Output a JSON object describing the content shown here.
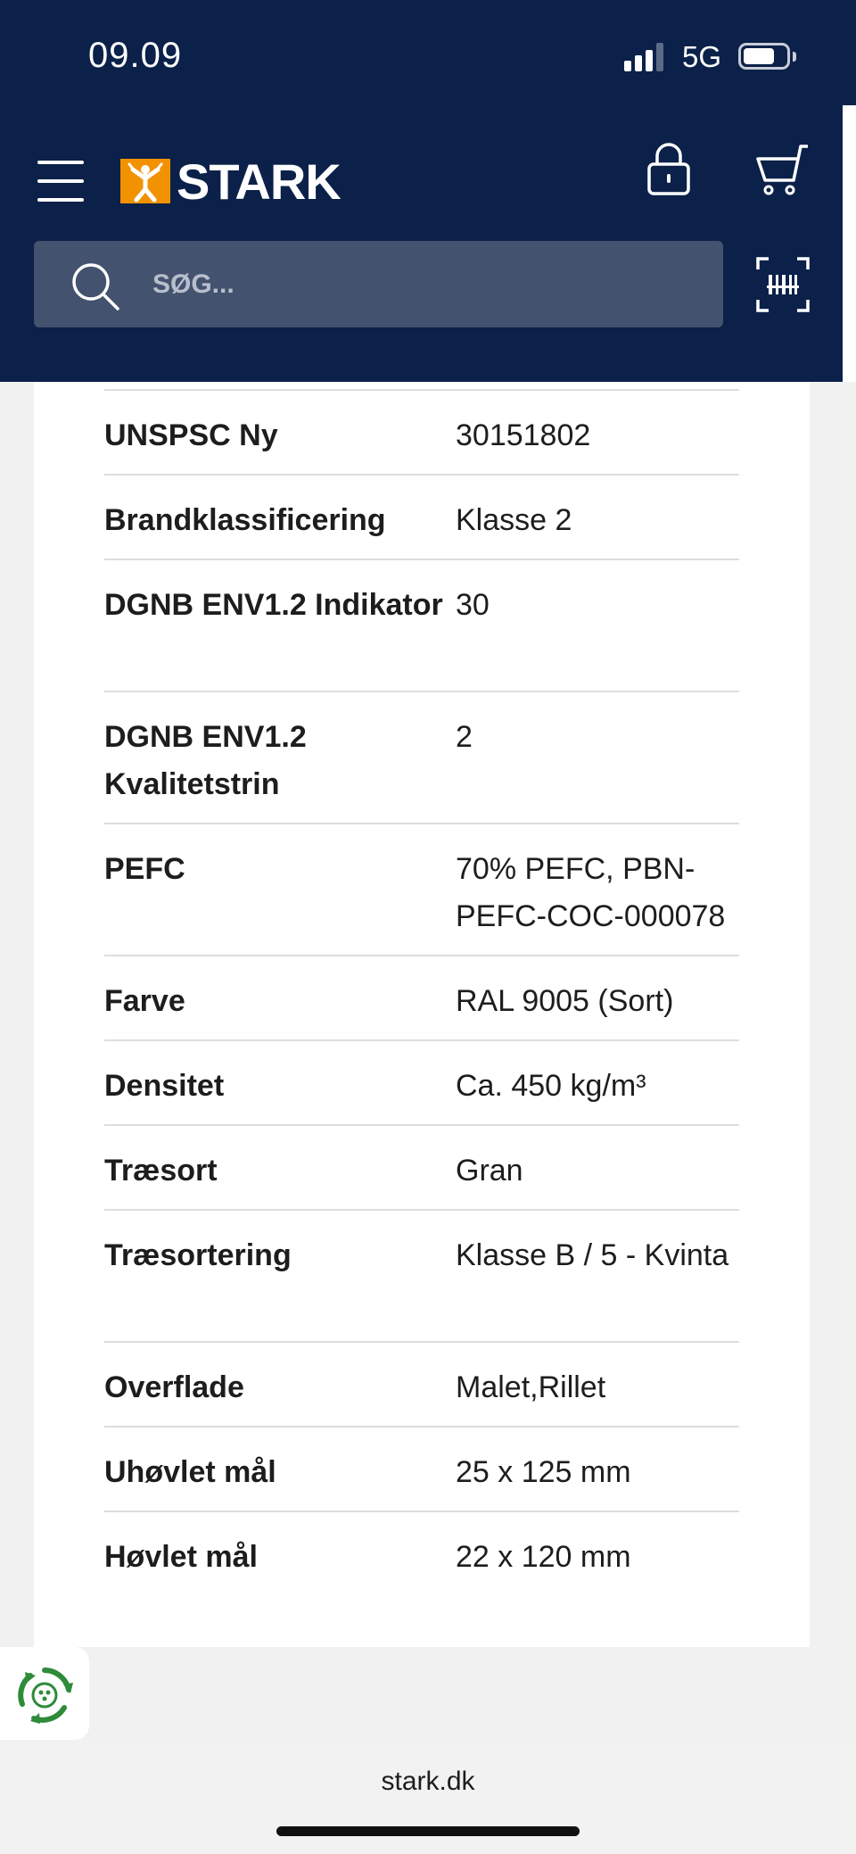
{
  "status_bar": {
    "time": "09.09",
    "network": "5G"
  },
  "header": {
    "logo_text": "STARK",
    "brand_color": "#f39200",
    "background_color": "#0b2149",
    "icons": [
      "menu-icon",
      "lock-icon",
      "cart-icon",
      "barcode-scan-icon"
    ]
  },
  "search": {
    "placeholder": "SØG..."
  },
  "specs": [
    {
      "label": "UNSPSC Ny",
      "value": "30151802"
    },
    {
      "label": "Brandklassificering",
      "value": "Klasse 2"
    },
    {
      "label": "DGNB ENV1.2 Indikator",
      "value": "30"
    },
    {
      "label": "DGNB ENV1.2 Kvalitetstrin",
      "value": "2"
    },
    {
      "label": "PEFC",
      "value": "70% PEFC, PBN-PEFC-COC-000078"
    },
    {
      "label": "Farve",
      "value": "RAL 9005 (Sort)"
    },
    {
      "label": "Densitet",
      "value": "Ca. 450 kg/m³"
    },
    {
      "label": "Træsort",
      "value": "Gran"
    },
    {
      "label": "Træsortering",
      "value": "Klasse B / 5 - Kvinta"
    },
    {
      "label": "Overflade",
      "value": "Malet,Rillet"
    },
    {
      "label": "Uhøvlet mål",
      "value": "25 x 125 mm"
    },
    {
      "label": "Høvlet mål",
      "value": "22 x 120 mm"
    }
  ],
  "browser": {
    "url": "stark.dk"
  }
}
